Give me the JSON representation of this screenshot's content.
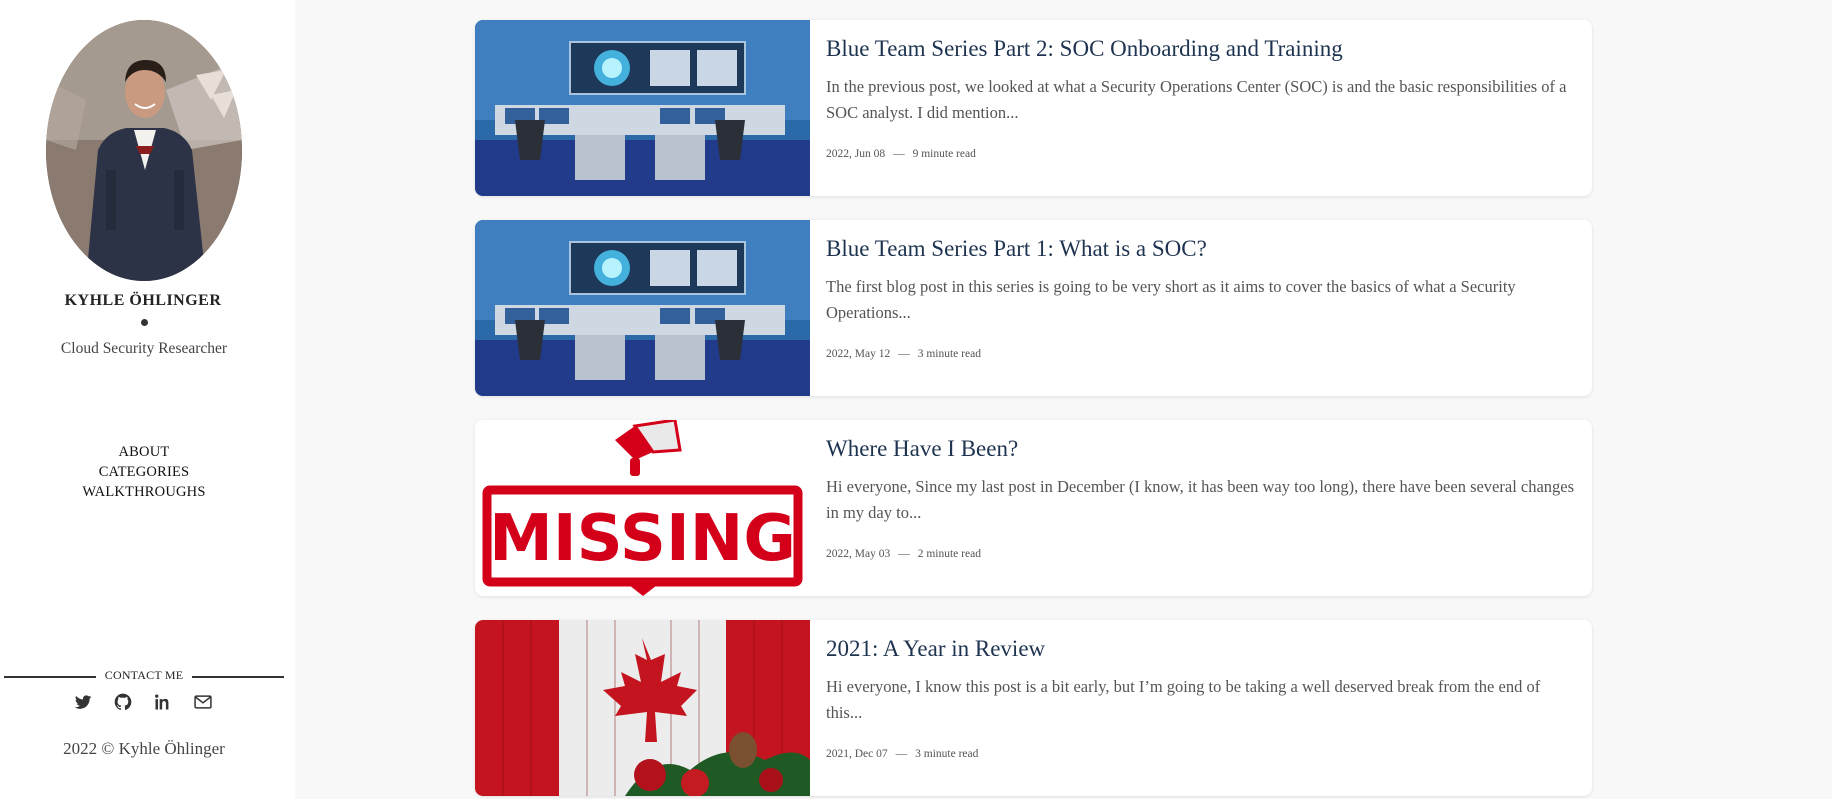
{
  "sidebar": {
    "author_name": "KYHLE ÖHLINGER",
    "author_role": "Cloud Security Researcher",
    "nav": [
      "ABOUT",
      "CATEGORIES",
      "WALKTHROUGHS"
    ],
    "contact_label": "CONTACT ME",
    "social_icons": [
      "twitter-icon",
      "github-icon",
      "linkedin-icon",
      "email-icon"
    ],
    "copyright": "2022 © Kyhle Öhlinger"
  },
  "posts": [
    {
      "title": "Blue Team Series Part 2: SOC Onboarding and Training",
      "excerpt": "In the previous post, we looked at what a Security Operations Center (SOC) is and the basic responsibilities of a SOC analyst. I did mention...",
      "date": "2022, Jun 08",
      "read_time": "9 minute read",
      "thumbnail": "soc-control-room"
    },
    {
      "title": "Blue Team Series Part 1: What is a SOC?",
      "excerpt": "The first blog post in this series is going to be very short as it aims to cover the basics of what a Security Operations...",
      "date": "2022, May 12",
      "read_time": "3 minute read",
      "thumbnail": "soc-control-room"
    },
    {
      "title": "Where Have I Been?",
      "excerpt": "Hi everyone, Since my last post in December (I know, it has been way too long), there have been several changes in my day to...",
      "date": "2022, May 03",
      "read_time": "2 minute read",
      "thumbnail": "missing-sign",
      "thumbnail_text": "MISSING"
    },
    {
      "title": "2021: A Year in Review",
      "excerpt": "Hi everyone, I know this post is a bit early, but I’m going to be taking a well deserved break from the end of this...",
      "date": "2021, Dec 07",
      "read_time": "3 minute read",
      "thumbnail": "canada-flag-christmas"
    }
  ],
  "colors": {
    "title": "#1e3350",
    "accent_red": "#d4001a",
    "page_bg": "#f8f8f8"
  }
}
